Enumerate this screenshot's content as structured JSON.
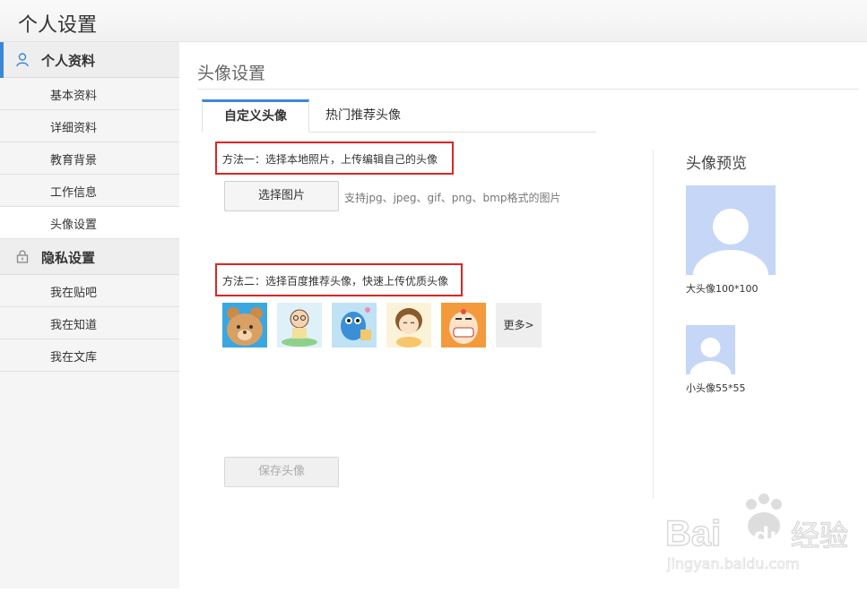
{
  "header": {
    "title": "个人设置"
  },
  "sidebar": {
    "sections": [
      {
        "label": "个人资料",
        "icon": "user-icon",
        "items": [
          "基本资料",
          "详细资料",
          "教育背景",
          "工作信息",
          "头像设置"
        ]
      },
      {
        "label": "隐私设置",
        "icon": "lock-icon",
        "items": [
          "我在贴吧",
          "我在知道",
          "我在文库"
        ]
      }
    ],
    "active_item": "头像设置"
  },
  "main": {
    "title": "头像设置",
    "tabs": [
      {
        "label": "自定义头像",
        "active": true
      },
      {
        "label": "热门推荐头像",
        "active": false
      }
    ],
    "method1": {
      "label": "方法一：选择本地照片，上传编辑自己的头像",
      "button": "选择图片",
      "hint": "支持jpg、jpeg、gif、png、bmp格式的图片"
    },
    "method2": {
      "label": "方法二：选择百度推荐头像，快速上传优质头像",
      "avatars": [
        "bear-avatar",
        "cartoon-boy-avatar",
        "blue-creature-avatar",
        "girl-avatar",
        "funny-face-avatar"
      ],
      "more": "更多>"
    },
    "save_button": "保存头像",
    "preview": {
      "title": "头像预览",
      "large_caption": "大头像100*100",
      "small_caption": "小头像55*55"
    }
  },
  "watermark": {
    "brand": "Bai",
    "brand2": "du",
    "cn": "经验",
    "url": "jingyan.baidu.com"
  },
  "colors": {
    "accent": "#3a87d8",
    "highlight_box": "#e02424",
    "avatar_placeholder": "#c5d6f7"
  }
}
